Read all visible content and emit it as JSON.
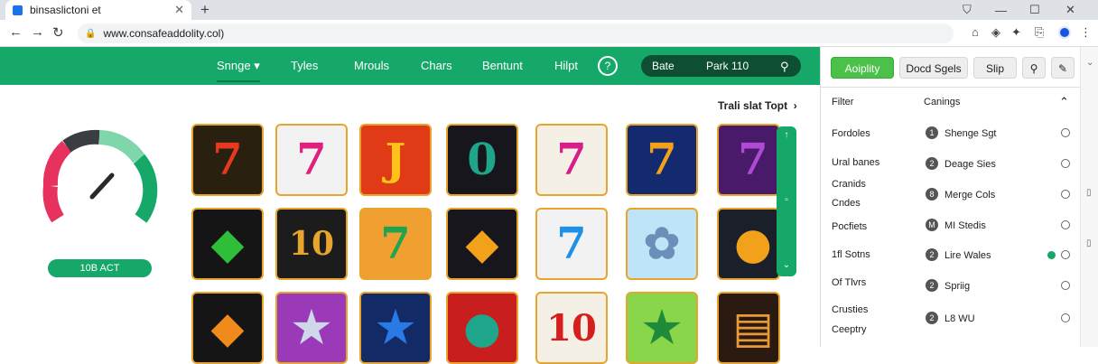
{
  "browser": {
    "tab_title": "binsaslictoni et",
    "tab_close": "✕",
    "new_tab": "+",
    "url": "www.consafeaddolity.col)",
    "window_controls": [
      "—",
      "☐",
      "✕"
    ]
  },
  "nav": {
    "items": [
      "Snnge ▾",
      "Tyles",
      "Mrouls",
      "Chars",
      "Bentunt",
      "Hilpt"
    ],
    "help": "?",
    "search_left": "Bate",
    "search_right": "Park 110",
    "search_icon": "⚲"
  },
  "main": {
    "trail": "Trali slat Topt",
    "gauge_button": "10B ACT",
    "tile_glyphs": [
      [
        "7",
        "7",
        "J",
        "0",
        "7",
        "7",
        "7"
      ],
      [
        "◆",
        "10",
        "7",
        "◆",
        "7",
        "✿",
        "●"
      ],
      [
        "◆",
        "★",
        "★",
        "●",
        "10",
        "★",
        "▤"
      ]
    ],
    "scroll": {
      "up": "↑",
      "mid": "▫",
      "down": "⌄"
    }
  },
  "panel": {
    "buttons": [
      "Aoiplity",
      "Docd Sgels",
      "Slip",
      "⚲",
      "✎"
    ],
    "filter_label": "Filter",
    "category_label": "Canings",
    "filters": [
      "Fordoles",
      "Ural banes",
      "Cranids",
      "Cndes",
      "Pocfiets",
      "1fl Sotns",
      "Of Tlvrs",
      "Crusties",
      "Ceeptry"
    ],
    "options": [
      {
        "num": "1",
        "label": "Shenge Sgt"
      },
      {
        "num": "2",
        "label": "Deage Sies"
      },
      {
        "num": "8",
        "label": "Merge Cols"
      },
      {
        "num": "M",
        "label": "MI Stedis"
      },
      {
        "num": "2",
        "label": "Lire Wales"
      },
      {
        "num": "2",
        "label": "Spriig"
      },
      {
        "num": "2",
        "label": "L8 WU"
      }
    ],
    "colors": {
      "accent": "#16a868",
      "apply": "#4ac24a"
    }
  }
}
